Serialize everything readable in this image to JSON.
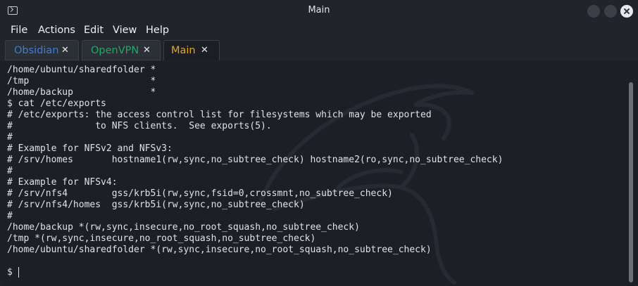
{
  "window": {
    "title": "Main"
  },
  "menu": [
    "File",
    "Actions",
    "Edit",
    "View",
    "Help"
  ],
  "tabs": [
    {
      "label": "Obsidian",
      "color": "#3d7fd6"
    },
    {
      "label": "OpenVPN",
      "color": "#22a86a"
    },
    {
      "label": "Main",
      "color": "#e2a81f"
    }
  ],
  "terminal": {
    "lines": [
      "/home/ubuntu/sharedfolder *",
      "/tmp                      *",
      "/home/backup              *",
      "$ cat /etc/exports",
      "# /etc/exports: the access control list for filesystems which may be exported",
      "#               to NFS clients.  See exports(5).",
      "#",
      "# Example for NFSv2 and NFSv3:",
      "# /srv/homes       hostname1(rw,sync,no_subtree_check) hostname2(ro,sync,no_subtree_check)",
      "#",
      "# Example for NFSv4:",
      "# /srv/nfs4        gss/krb5i(rw,sync,fsid=0,crossmnt,no_subtree_check)",
      "# /srv/nfs4/homes  gss/krb5i(rw,sync,no_subtree_check)",
      "#",
      "/home/backup *(rw,sync,insecure,no_root_squash,no_subtree_check)",
      "/tmp *(rw,sync,insecure,no_root_squash,no_subtree_check)",
      "/home/ubuntu/sharedfolder *(rw,sync,insecure,no_root_squash,no_subtree_check)"
    ],
    "prompt": "$ "
  },
  "icons": {
    "app": "terminal-icon",
    "tab_close": "close-icon",
    "window_controls": [
      "minimize-button",
      "maximize-button",
      "close-button"
    ]
  },
  "colors": {
    "background": "#1c1f26",
    "titlebar": "#21242b",
    "text": "#dfe2e6"
  }
}
